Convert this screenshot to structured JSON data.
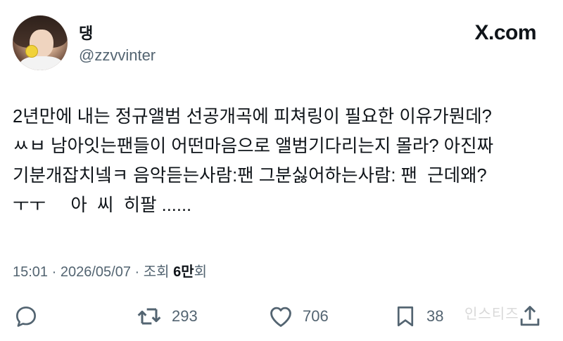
{
  "author": {
    "display_name": "댕",
    "handle": "@zzvvinter"
  },
  "brand": {
    "label": "X.com"
  },
  "tweet": {
    "lines": [
      "2년만에 내는 정규앨범 선공개곡에 피쳐링이 필요한 이유가뭔데?",
      "ㅆㅂ 남아잇는팬들이 어떤마음으로 앨범기다리는지 몰라? 아진짜",
      "기분개잡치넼ㅋ 음악듣는사람:팬 그분싫어하는사람: 팬  근데왜?",
      "ㅜㅜ     아  씨  히팔 ......"
    ]
  },
  "meta": {
    "time": "15:01",
    "separator": "·",
    "date": "2026/05/07",
    "views_label": "조회",
    "views_count": "6만",
    "views_suffix": "회"
  },
  "actions": {
    "reply_count": "",
    "retweet_count": "293",
    "like_count": "706",
    "bookmark_count": "38"
  },
  "watermark": "인스티즈",
  "icons": [
    "avatar",
    "x-logo",
    "reply-icon",
    "retweet-icon",
    "like-icon",
    "bookmark-icon",
    "share-icon"
  ],
  "colors": {
    "text": "#0f1419",
    "secondary": "#536471"
  }
}
